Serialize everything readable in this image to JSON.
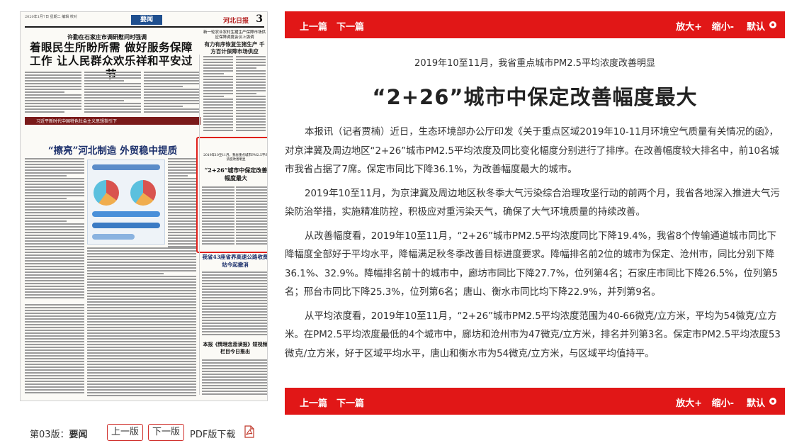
{
  "paper": {
    "date_line": "2020年1月7日 星期二 编辑 校对",
    "section": "要闻",
    "paper_name": "河北日报",
    "page_num": "3",
    "headline_kicker": "许勤在石家庄市调研慰问时强调",
    "headline_main": "着眼民生所盼所需 做好服务保障工作 让人民群众欢乐祥和平安过节",
    "right_kicker": "新一轮农业农村生猪生产保障市场供应保障调度会议上强调",
    "right_headline": "有力有序恢复生猪生产 千方百计保障市场供应",
    "banner_text": "习近平新时代中国特色社会主义思想指引下",
    "section_headline": "“擦亮”河北制造 外贸稳中提质",
    "boxed_kicker": "2019年10至11月，我省重点城市PM2.5平均浓度改善明显",
    "boxed_headline": "“2+26”城市中保定改善幅度最大",
    "lower_headline": "我省43座省界高速公路收费站今起撤消",
    "bottom_headline": "本报《情理念悲读报》短视频栏目今日推出"
  },
  "left_nav": {
    "edition_prefix": "第03版：",
    "edition_name": "要闻",
    "prev_label": "上一版",
    "next_label": "下一版",
    "pdf_label": "PDF版下载",
    "pdf_icon": "pdf-icon"
  },
  "toolbar": {
    "prev_article": "上一篇",
    "next_article": "下一篇",
    "zoom_in": "放大+",
    "zoom_out": "缩小-",
    "default": "默认"
  },
  "article": {
    "subtitle": "2019年10至11月，我省重点城市PM2.5平均浓度改善明显",
    "title": "“2+26”城市中保定改善幅度最大",
    "paragraphs": [
      "本报讯（记者贾楠）近日，生态环境部办公厅印发《关于重点区域2019年10-11月环境空气质量有关情况的函》，对京津冀及周边地区“2+26”城市PM2.5平均浓度及同比变化幅度分别进行了排序。在改善幅度较大排名中，前10名城市我省占据了7席。保定市同比下降36.1%，为改善幅度最大的城市。",
      "2019年10至11月，为京津冀及周边地区秋冬季大气污染综合治理攻坚行动的前两个月，我省各地深入推进大气污染防治举措，实施精准防控，积极应对重污染天气，确保了大气环境质量的持续改善。",
      "从改善幅度看，2019年10至11月，“2+26”城市PM2.5平均浓度同比下降19.4%，我省8个传输通道城市同比下降幅度全部好于平均水平，降幅满足秋冬季改善目标进度要求。降幅排名前2位的城市为保定、沧州市，同比分别下降36.1%、32.9%。降幅排名前十的城市中，廊坊市同比下降27.7%，位列第4名；石家庄市同比下降26.5%，位列第5名；邢台市同比下降25.3%，位列第6名；唐山、衡水市同比均下降22.9%，并列第9名。",
      "从平均浓度看，2019年10至11月，“2+26”城市PM2.5平均浓度范围为40-66微克/立方米，平均为54微克/立方米。在PM2.5平均浓度最低的4个城市中，廊坊和沧州市为47微克/立方米，排名并列第3名。保定市PM2.5平均浓度53微克/立方米，好于区域平均水平，唐山和衡水市为54微克/立方米，与区域平均值持平。"
    ]
  },
  "colors": {
    "accent": "#e11717",
    "section_blue": "#1f4f8f"
  }
}
